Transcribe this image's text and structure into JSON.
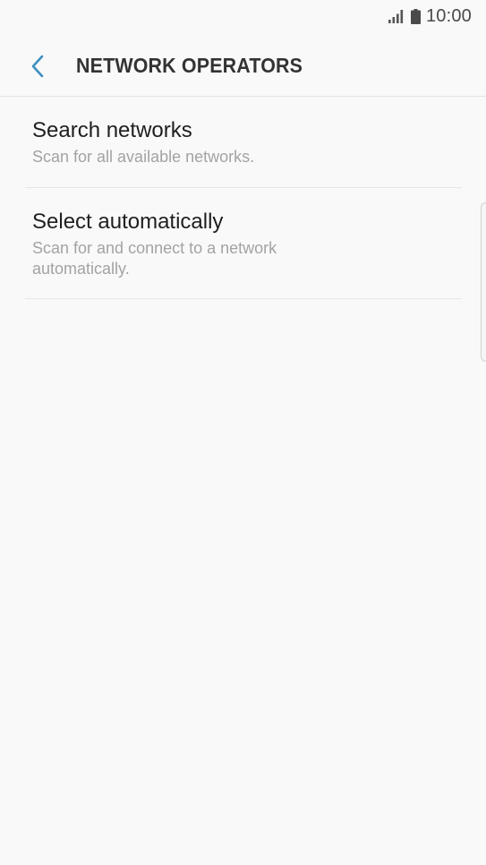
{
  "status_bar": {
    "time": "10:00",
    "signal_icon": "signal-bars-icon",
    "battery_icon": "battery-icon"
  },
  "header": {
    "back_icon": "chevron-left-icon",
    "title": "NETWORK OPERATORS"
  },
  "list": {
    "items": [
      {
        "title": "Search networks",
        "subtitle": "Scan for all available networks."
      },
      {
        "title": "Select automatically",
        "subtitle": "Scan for and connect to a network automatically."
      }
    ]
  },
  "colors": {
    "background": "#f9f9f9",
    "accent": "#3d8fbf",
    "title_text": "#333333",
    "item_title": "#1f1f1f",
    "item_subtitle": "#a3a3a3",
    "divider": "#e6e6e6"
  }
}
